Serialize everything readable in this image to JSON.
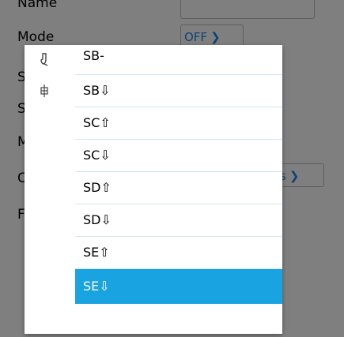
{
  "background_form": {
    "rows": [
      {
        "label": "Name"
      },
      {
        "label": "Mode"
      },
      {
        "label": "S"
      },
      {
        "label": "S"
      },
      {
        "label": "M"
      },
      {
        "label": "C"
      },
      {
        "label": "F"
      }
    ],
    "mode_select": {
      "value": "OFF",
      "chevron": "chevron-down-icon"
    },
    "partial_select": {
      "value": "s",
      "chevron": "chevron-down-icon"
    }
  },
  "popup": {
    "icons": [
      "switch-icon",
      "fuse-icon"
    ],
    "items": [
      {
        "label": "SB-"
      },
      {
        "label": "SB⇩"
      },
      {
        "label": "SC⇧"
      },
      {
        "label": "SC⇩"
      },
      {
        "label": "SD⇧"
      },
      {
        "label": "SD⇩"
      },
      {
        "label": "SE⇧"
      },
      {
        "label": "SE⇩"
      }
    ],
    "selected_index": 7
  },
  "colors": {
    "selected_bg": "#1aa3e1",
    "divider": "#cfe8f5",
    "accent": "#1e88e5"
  }
}
